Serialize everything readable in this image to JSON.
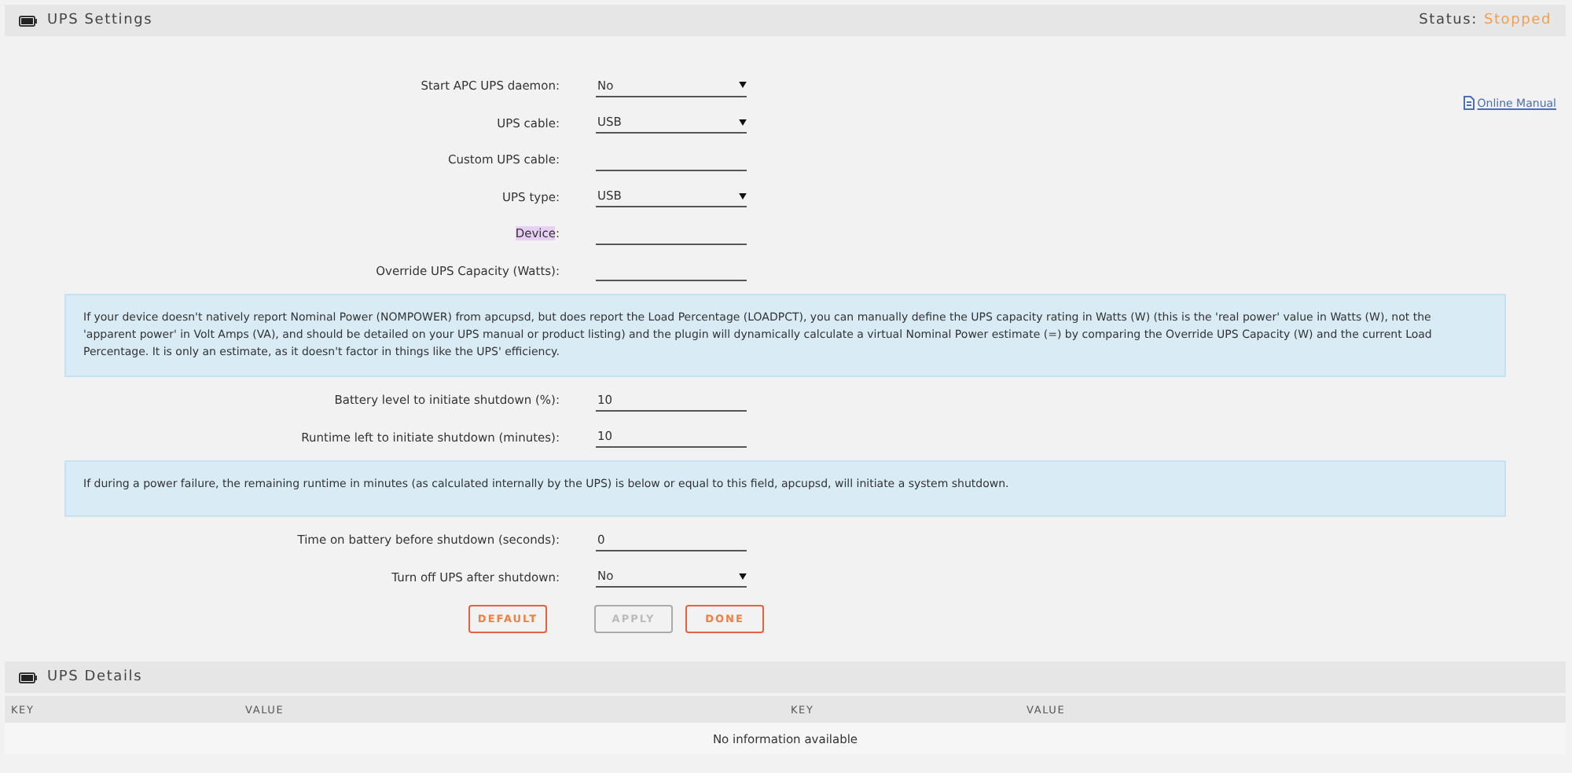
{
  "settings_panel": {
    "title": "UPS Settings",
    "status_label": "Status:",
    "status_value": "Stopped"
  },
  "manual_link": "Online Manual",
  "form": [
    {
      "kind": "select",
      "label": "Start APC UPS daemon:",
      "value": "No",
      "highlighted": false
    },
    {
      "kind": "select",
      "label": "UPS cable:",
      "value": "USB",
      "highlighted": false
    },
    {
      "kind": "input",
      "label": "Custom UPS cable:",
      "highlighted": false
    },
    {
      "kind": "select",
      "label": "UPS type:",
      "value": "USB",
      "highlighted": false
    },
    {
      "kind": "input",
      "label": "Device",
      "suffix": ":",
      "highlighted": true
    },
    {
      "kind": "input",
      "label": "Override UPS Capacity (Watts):",
      "highlighted": false
    },
    {
      "kind": "info",
      "text": "If your device doesn't natively report Nominal Power (NOMPOWER) from apcupsd, but does report the Load Percentage (LOADPCT), you can manually define the UPS capacity rating in Watts (W) (this is the 'real power' value in Watts (W), not the 'apparent power' in Volt Amps (VA), and should be detailed on your UPS manual or product listing) and the plugin will dynamically calculate a virtual Nominal Power estimate (=) by comparing the Override UPS Capacity (W) and the current Load Percentage. It is only an estimate, as it doesn't factor in things like the UPS' efficiency."
    },
    {
      "kind": "input",
      "label": "Battery level to initiate shutdown (%):",
      "value": "10",
      "highlighted": false
    },
    {
      "kind": "input",
      "label": "Runtime left to initiate shutdown (minutes):",
      "value": "10",
      "highlighted": false
    },
    {
      "kind": "info",
      "text": "If during a power failure, the remaining runtime in minutes (as calculated internally by the UPS) is below or equal to this field, apcupsd, will initiate a system shutdown."
    },
    {
      "kind": "input",
      "label": "Time on battery before shutdown (seconds):",
      "value": "0",
      "highlighted": false
    },
    {
      "kind": "select",
      "label": "Turn off UPS after shutdown:",
      "value": "No",
      "highlighted": false
    }
  ],
  "buttons": [
    {
      "label": "DEFAULT",
      "disabled": false
    },
    {
      "label": "APPLY",
      "disabled": true
    },
    {
      "label": "DONE",
      "disabled": false
    }
  ],
  "details_panel": {
    "title": "UPS Details",
    "columns": [
      "KEY",
      "VALUE",
      "KEY",
      "VALUE"
    ],
    "empty_message": "No information available"
  }
}
